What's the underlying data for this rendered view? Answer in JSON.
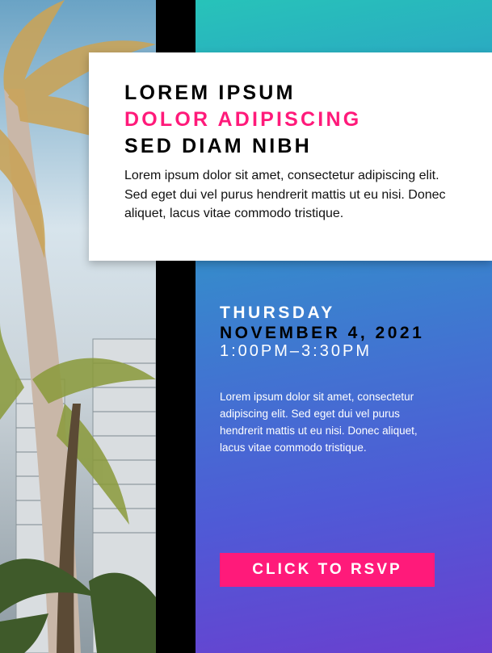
{
  "headline": {
    "line1": "LOREM IPSUM",
    "line2": "DOLOR ADIPISCING",
    "line3": "SED DIAM NIBH",
    "body": "Lorem ipsum dolor sit amet, consectetur adipiscing elit. Sed eget dui vel purus hendrerit mattis ut eu nisi. Donec aliquet, lacus vitae commodo tristique."
  },
  "event": {
    "day": "THURSDAY",
    "date": "NOVEMBER 4, 2021",
    "time": "1:00PM–3:30PM",
    "description": "Lorem ipsum dolor sit amet, consectetur adipiscing elit. Sed eget dui vel purus hendrerit mattis ut eu nisi. Donec aliquet, lacus vitae commodo tristique."
  },
  "cta": {
    "label": "CLICK TO RSVP"
  },
  "colors": {
    "accent": "#ff1a7a",
    "gradient_top": "#27c3b9",
    "gradient_bottom": "#6a3fcf",
    "bar": "#000000"
  }
}
